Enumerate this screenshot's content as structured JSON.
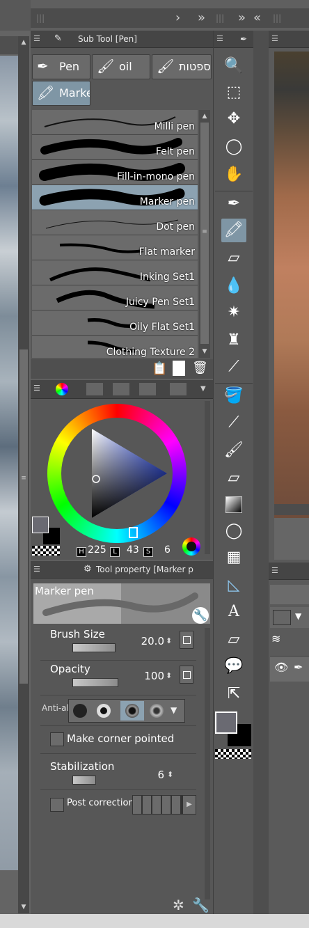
{
  "subtool_panel": {
    "title": "Sub Tool [Pen]",
    "tabs": [
      "Pen",
      "oil",
      "ספטות",
      "Marke"
    ],
    "brushes": [
      "Milli pen",
      "Felt pen",
      "Fill-in-mono pen",
      "Marker pen",
      "Dot pen",
      "Flat marker",
      "Inking Set1",
      "Juicy Pen Set1",
      "Oily Flat Set1",
      "Clothing Texture 2"
    ],
    "selected_brush": "Marker pen"
  },
  "color_panel": {
    "h_label": "H",
    "h_value": "225",
    "l_label": "L",
    "l_value": "43",
    "s_label": "S",
    "s_value": "6",
    "main_color": "#6a6a72",
    "sub_color": "#000000"
  },
  "tool_property": {
    "title": "Tool property [Marker p",
    "preview_name": "Marker pen",
    "brush_size_label": "Brush Size",
    "brush_size_value": "20.0",
    "opacity_label": "Opacity",
    "opacity_value": "100",
    "antialias_label": "Anti-al",
    "corner_label": "Make corner pointed",
    "stabilization_label": "Stabilization",
    "stabilization_value": "6",
    "post_correction_label": "Post correction"
  },
  "toolbar": {
    "tools": [
      "zoom-icon",
      "operation-icon",
      "move-icon",
      "lasso-icon",
      "hand-icon",
      "pen-icon",
      "marker-icon",
      "eraser-icon",
      "blend-icon",
      "spark-icon",
      "airbrush-icon",
      "dropper-icon",
      "fill-icon",
      "line-icon",
      "brush-icon",
      "eraser2-icon",
      "gradient-icon",
      "selection-icon",
      "frame-icon",
      "ruler-icon",
      "text-icon",
      "correct-line-icon",
      "balloon-icon",
      "arrow-tool-icon"
    ],
    "active_tool": "marker-icon"
  }
}
